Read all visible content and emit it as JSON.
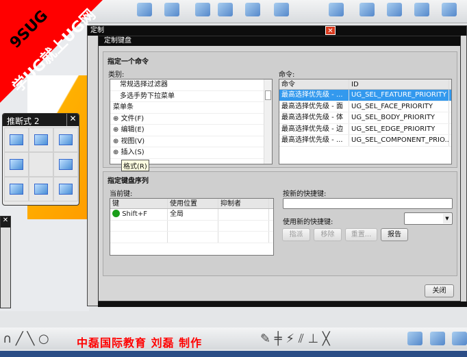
{
  "watermark": {
    "line1": "9SUG",
    "line2": "学UG就上UG网"
  },
  "panel": {
    "title": "推断式 2",
    "close": "✕"
  },
  "panel2": {
    "close": "✕"
  },
  "outer_dialog": {
    "title": "定制",
    "close": "✕"
  },
  "dialog": {
    "title": "定制键盘",
    "group1": {
      "title": "指定一个命令",
      "category_label": "类别:",
      "command_label": "命令:",
      "categories": [
        "常规选择过滤器",
        "多选手势下拉菜单",
        "菜单条",
        "文件(F)",
        "编辑(E)",
        "视图(V)",
        "插入(S)"
      ],
      "tooltip": "格式(R)",
      "command_columns": [
        "命令",
        "ID"
      ],
      "commands": [
        {
          "name": "最高选择优先级 - ...",
          "id": "UG_SEL_FEATURE_PRIORITY",
          "selected": true
        },
        {
          "name": "最高选择优先级 - 面",
          "id": "UG_SEL_FACE_PRIORITY"
        },
        {
          "name": "最高选择优先级 - 体",
          "id": "UG_SEL_BODY_PRIORITY"
        },
        {
          "name": "最高选择优先级 - 边",
          "id": "UG_SEL_EDGE_PRIORITY"
        },
        {
          "name": "最高选择优先级 - ...",
          "id": "UG_SEL_COMPONENT_PRIO..."
        }
      ]
    },
    "group2": {
      "title": "指定键盘序列",
      "current_keys_label": "当前键:",
      "columns": [
        "键",
        "使用位置",
        "抑制者"
      ],
      "keys": [
        {
          "key": "Shift+F",
          "location": "全局",
          "suppressed_by": "",
          "status_color": "#1a9e1a"
        }
      ],
      "press_new_label": "按新的快捷键:",
      "press_new_value": "",
      "use_new_label": "使用新的快捷键:",
      "use_new_value": "",
      "buttons": {
        "assign": "指派",
        "remove": "移除",
        "reset": "重置...",
        "report": "报告"
      }
    },
    "close_button": "关闭"
  },
  "credit": "中磊国际教育  刘磊  制作",
  "colors": {
    "selection": "#3399ee",
    "titlebar": "#0d0d0d",
    "watermark": "#ff0000"
  }
}
